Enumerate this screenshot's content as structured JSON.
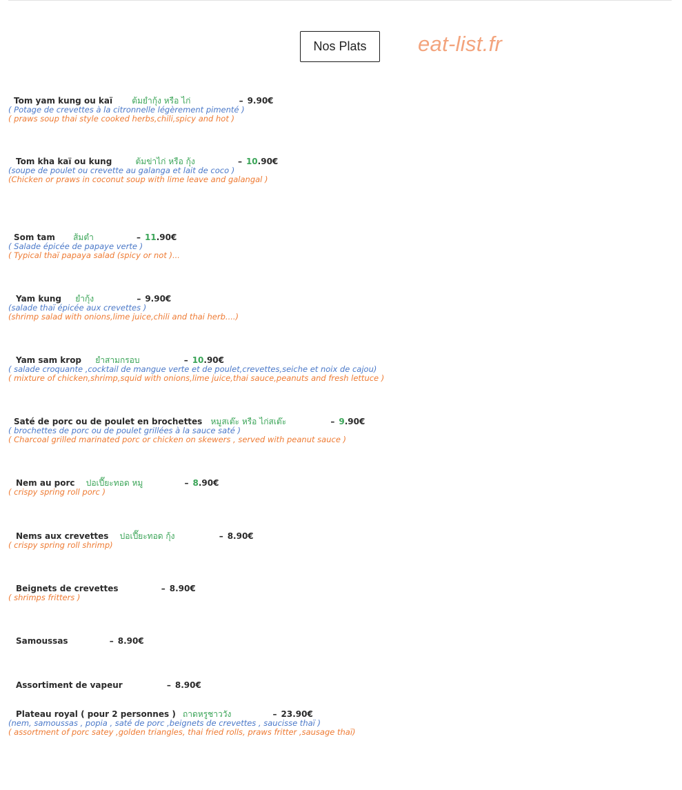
{
  "header": {
    "button_label": "Nos Plats",
    "logo": "eat-list.fr"
  },
  "dishes": [
    {
      "name": "Tom yam kung  ou kaï",
      "thai": "ต้มยำกุ้ง หรือ ไก่",
      "price_hl": "",
      "price": "9.90€",
      "fr": "( Potage de crevettes  à la citronnelle légèrement pimenté )",
      "en": "( praws soup thai style cooked herbs,chili,spicy and hot )"
    },
    {
      "name": "Tom kha kaï ou kung",
      "thai": "ต้มข่าไก่ หรือ กุ้ง",
      "price_hl": "10",
      "price": ".90€",
      "fr": "(soupe de poulet ou crevette  au galanga et lait de coco )",
      "en": "(Chicken or praws in coconut soup with lime leave and galangal )"
    },
    {
      "name": "Som tam",
      "thai": "ส้มตำ",
      "price_hl": "11",
      "price": ".90€",
      "fr": "( Salade épicée de papaye verte  )",
      "en": "( Typical thaï papaya salad (spicy or not )..."
    },
    {
      "name": "Yam kung",
      "thai": "ยำกุ้ง",
      "price_hl": "",
      "price": "9.90€",
      "fr": "(salade thaï épicée aux crevettes )",
      "en": "(shrimp salad with onions,lime juice,chili and thai herb....)"
    },
    {
      "name": "Yam sam krop",
      "thai": "ยำสามกรอบ",
      "price_hl": "10",
      "price": ".90€",
      "fr": "( salade croquante ,cocktail de mangue verte et de poulet,crevettes,seiche et noix de cajou)",
      "en": "( mixture of chicken,shrimp,squid with onions,lime juice,thai sauce,peanuts and fresh lettuce )"
    },
    {
      "name": "Saté de porc ou de poulet en brochettes",
      "thai": "หมูสเต๊ะ หรือ ไก่สเต๊ะ",
      "price_hl": "9",
      "price": ".90€",
      "fr": "( brochettes de porc ou de poulet grillées à la sauce saté )",
      "en": "( Charcoal grilled marinated porc or chicken on skewers , served with peanut sauce )"
    },
    {
      "name": "Nem au porc",
      "thai": "ปอเปี๊ยะทอด หมู",
      "price_hl": "8",
      "price": ".90€",
      "fr": "",
      "en": "( crispy spring roll porc )"
    },
    {
      "name": "Nems aux crevettes",
      "thai": "ปอเปี๊ยะทอด กุ้ง",
      "price_hl": "",
      "price": "8.90€",
      "fr": "",
      "en": "( crispy spring roll shrimp)"
    },
    {
      "name": "Beignets de crevettes",
      "thai": "",
      "price_hl": "",
      "price": "8.90€",
      "fr": "",
      "en": "( shrimps fritters )"
    },
    {
      "name": "Samoussas",
      "thai": "",
      "price_hl": "",
      "price": "8.90€",
      "fr": "",
      "en": ""
    },
    {
      "name": "Assortiment de vapeur",
      "thai": "",
      "price_hl": "",
      "price": "8.90€",
      "fr": "",
      "en": ""
    },
    {
      "name": "Plateau royal  ( pour 2 personnes )",
      "thai": "ถาดหรูชาววัง",
      "price_hl": "",
      "price": "23.90€",
      "fr": "(nem, samoussas , popia , saté de porc ,beignets de crevettes , saucisse thaï )",
      "en": "( assortment of porc satey ,golden triangles, thai fried rolls, praws fritter ,sausage thaï)"
    }
  ]
}
